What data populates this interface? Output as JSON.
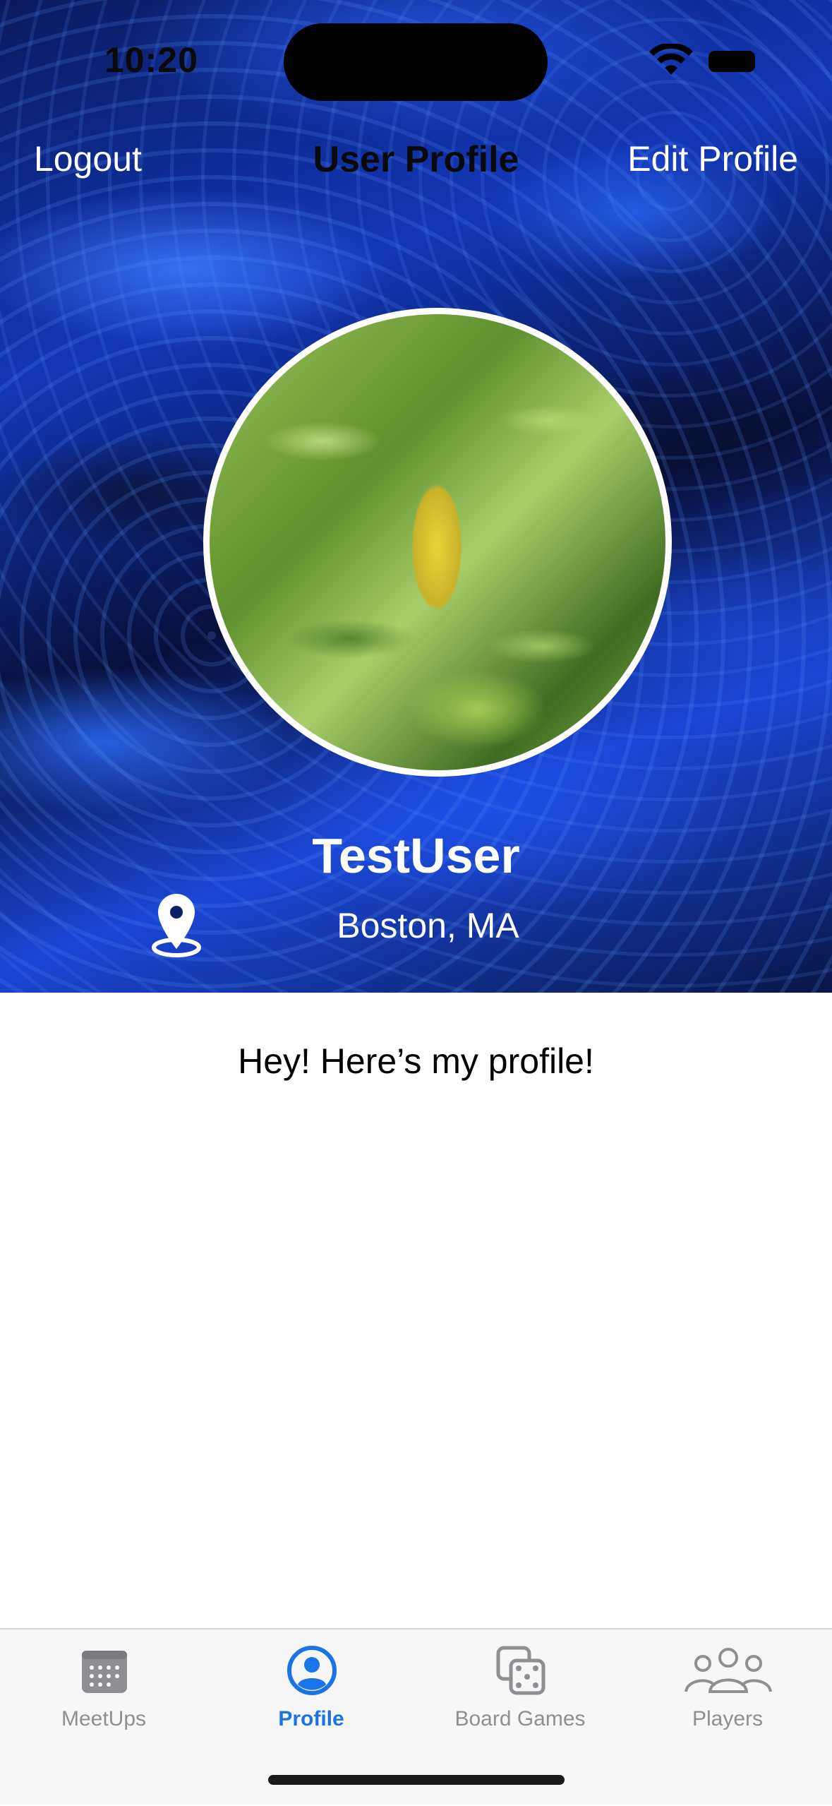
{
  "status_bar": {
    "time": "10:20"
  },
  "nav": {
    "logout": "Logout",
    "title": "User Profile",
    "edit": "Edit Profile"
  },
  "profile": {
    "username": "TestUser",
    "location": "Boston, MA",
    "bio": "Hey! Here’s my profile!"
  },
  "tabs": [
    {
      "label": "MeetUps",
      "icon": "calendar-icon",
      "active": false
    },
    {
      "label": "Profile",
      "icon": "person-circle-icon",
      "active": true
    },
    {
      "label": "Board Games",
      "icon": "dice-icon",
      "active": false
    },
    {
      "label": "Players",
      "icon": "people-group-icon",
      "active": false
    }
  ],
  "colors": {
    "accent": "#1a73e8",
    "tab_inactive": "#8e8e93"
  }
}
